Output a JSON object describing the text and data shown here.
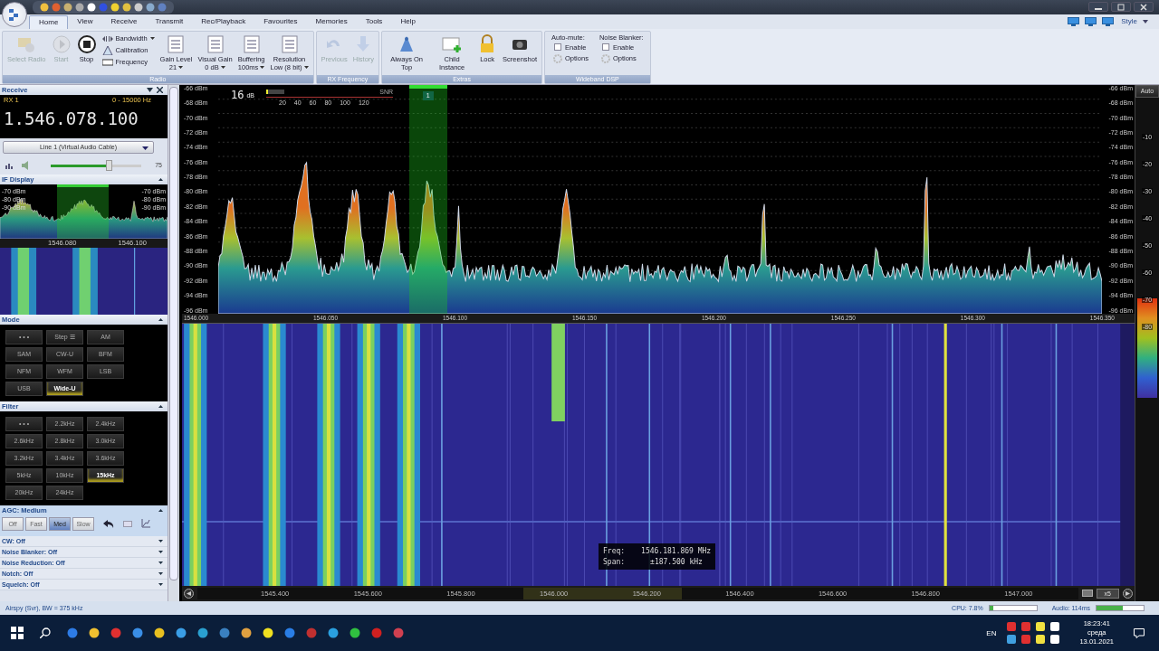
{
  "tabs": [
    {
      "label": "Home",
      "selected": true
    },
    {
      "label": "View",
      "selected": false
    },
    {
      "label": "Receive",
      "selected": false
    },
    {
      "label": "Transmit",
      "selected": false
    },
    {
      "label": "Rec/Playback",
      "selected": false
    },
    {
      "label": "Favourites",
      "selected": false
    },
    {
      "label": "Memories",
      "selected": false
    },
    {
      "label": "Tools",
      "selected": false
    },
    {
      "label": "Help",
      "selected": false
    }
  ],
  "style_menu": "Style",
  "ribbon": [
    {
      "title": "Radio",
      "items": [
        {
          "kind": "big",
          "label": "Select Radio",
          "disabled": true
        },
        {
          "kind": "big",
          "label": "Start",
          "disabled": true
        },
        {
          "kind": "big",
          "label": "Stop",
          "disabled": false
        },
        {
          "kind": "stack",
          "entries": [
            "Bandwidth",
            "Calibration",
            "Frequency"
          ]
        },
        {
          "kind": "dropdown",
          "label": "Gain Level",
          "value": "21"
        },
        {
          "kind": "dropdown",
          "label": "Visual Gain",
          "value": "0 dB"
        },
        {
          "kind": "dropdown",
          "label": "Buffering",
          "value": "100ms"
        },
        {
          "kind": "dropdown",
          "label": "Resolution",
          "value": "Low (8 bit)"
        }
      ]
    },
    {
      "title": "RX Frequency",
      "items": [
        {
          "kind": "big",
          "label": "Previous",
          "disabled": true
        },
        {
          "kind": "big",
          "label": "History",
          "disabled": true
        }
      ]
    },
    {
      "title": "Extras",
      "items": [
        {
          "kind": "big",
          "label": "Always On Top",
          "disabled": false
        },
        {
          "kind": "big",
          "label": "Child Instance",
          "disabled": false
        },
        {
          "kind": "big",
          "label": "Lock",
          "disabled": false
        },
        {
          "kind": "big",
          "label": "Screenshot",
          "disabled": false
        }
      ]
    },
    {
      "title": "Wideband DSP",
      "items": [
        {
          "kind": "options",
          "label": "Auto-mute:",
          "check_label": "Enable",
          "checked": false,
          "options_label": "Options"
        },
        {
          "kind": "options",
          "label": "Noise Blanker:",
          "check_label": "Enable",
          "checked": false,
          "options_label": "Options"
        }
      ]
    }
  ],
  "receive": {
    "title": "Receive",
    "rx": "RX 1",
    "range": "0 - 15000 Hz",
    "frequency": "1.546.078.100",
    "audio_device": "Line 1 (Virtual Audio Cable)",
    "volume": {
      "level": 0.65,
      "reading": "75"
    }
  },
  "if_display": {
    "title": "IF Display",
    "left_labels": [
      "-70 dBm",
      "-80 dBm",
      "-90 dBm"
    ],
    "right_labels": [
      "-70 dBm",
      "-80 dBm",
      "-90 dBm"
    ],
    "axis": [
      "1546.080",
      "1546.100"
    ]
  },
  "mode": {
    "title": "Mode",
    "buttons": [
      {
        "label": "• • •",
        "selected": false
      },
      {
        "label": "Step ☰",
        "selected": false
      },
      {
        "label": "AM",
        "selected": false
      },
      {
        "label": "SAM",
        "selected": false
      },
      {
        "label": "CW-U",
        "selected": false
      },
      {
        "label": "BFM",
        "selected": false
      },
      {
        "label": "NFM",
        "selected": false
      },
      {
        "label": "WFM",
        "selected": false
      },
      {
        "label": "LSB",
        "selected": false
      },
      {
        "label": "USB",
        "selected": false
      },
      {
        "label": "Wide-U",
        "selected": true
      }
    ]
  },
  "filter": {
    "title": "Filter",
    "buttons": [
      {
        "label": "• • •",
        "selected": false
      },
      {
        "label": "2.2kHz",
        "selected": false
      },
      {
        "label": "2.4kHz",
        "selected": false
      },
      {
        "label": "2.6kHz",
        "selected": false
      },
      {
        "label": "2.8kHz",
        "selected": false
      },
      {
        "label": "3.0kHz",
        "selected": false
      },
      {
        "label": "3.2kHz",
        "selected": false
      },
      {
        "label": "3.4kHz",
        "selected": false
      },
      {
        "label": "3.6kHz",
        "selected": false
      },
      {
        "label": "5kHz",
        "selected": false
      },
      {
        "label": "10kHz",
        "selected": false
      },
      {
        "label": "15kHz",
        "selected": true
      },
      {
        "label": "20kHz",
        "selected": false
      },
      {
        "label": "24kHz",
        "selected": false
      }
    ]
  },
  "agc": {
    "title": "AGC: Medium",
    "buttons": [
      {
        "label": "Off",
        "selected": false
      },
      {
        "label": "Fast",
        "selected": false
      },
      {
        "label": "Med",
        "selected": true
      },
      {
        "label": "Slow",
        "selected": false
      }
    ]
  },
  "sections": [
    {
      "title": "CW: Off",
      "expanded": false
    },
    {
      "title": "Noise Blanker: Off",
      "expanded": false
    },
    {
      "title": "Noise Reduction: Off",
      "expanded": false
    },
    {
      "title": "Notch: Off",
      "expanded": false
    },
    {
      "title": "Squelch: Off",
      "expanded": false
    }
  ],
  "spectrum": {
    "snr": {
      "value": "16",
      "unit": "dB",
      "label": "SNR",
      "level": 0.12,
      "scale": [
        "20",
        "40",
        "60",
        "80",
        "100",
        "120"
      ]
    },
    "marker": "1",
    "left_labels": [
      "-66 dBm",
      "-68 dBm",
      "-70 dBm",
      "-72 dBm",
      "-74 dBm",
      "-76 dBm",
      "-78 dBm",
      "-80 dBm",
      "-82 dBm",
      "-84 dBm",
      "-86 dBm",
      "-88 dBm",
      "-90 dBm",
      "-92 dBm",
      "-94 dBm",
      "-96 dBm"
    ],
    "right_labels": [
      "-66 dBm",
      "-68 dBm",
      "-70 dBm",
      "-72 dBm",
      "-74 dBm",
      "-76 dBm",
      "-78 dBm",
      "-80 dBm",
      "-82 dBm",
      "-84 dBm",
      "-86 dBm",
      "-88 dBm",
      "-90 dBm",
      "-92 dBm",
      "-94 dBm",
      "-96 dBm"
    ],
    "axis": [
      "1546.000",
      "1546.050",
      "1546.100",
      "1546.150",
      "1546.200",
      "1546.250",
      "1546.300",
      "1546.350"
    ]
  },
  "waterfall": {
    "tooltip": {
      "freq_label": "Freq:",
      "freq": "1546.181.869 MHz",
      "span_label": "Span:",
      "span": "±187.500 kHz"
    },
    "axis": [
      "1545.400",
      "1545.600",
      "1545.800",
      "1546.000",
      "1546.200",
      "1546.400",
      "1546.600",
      "1546.800",
      "1547.000"
    ],
    "zoom": "x5"
  },
  "color_scale": {
    "mode": "Auto",
    "labels": [
      "-10",
      "-20",
      "-30",
      "-40",
      "-50",
      "-60",
      "-70",
      "-80"
    ]
  },
  "status": {
    "text": "Airspy (Svr), BW = 375 kHz",
    "cpu": {
      "label": "CPU: 7.8%",
      "level": 0.08
    },
    "audio": {
      "label": "Audio: 114ms",
      "level": 0.55
    }
  },
  "taskbar": {
    "language": "EN",
    "time": "18:23:41",
    "day": "среда",
    "date": "13.01.2021"
  }
}
